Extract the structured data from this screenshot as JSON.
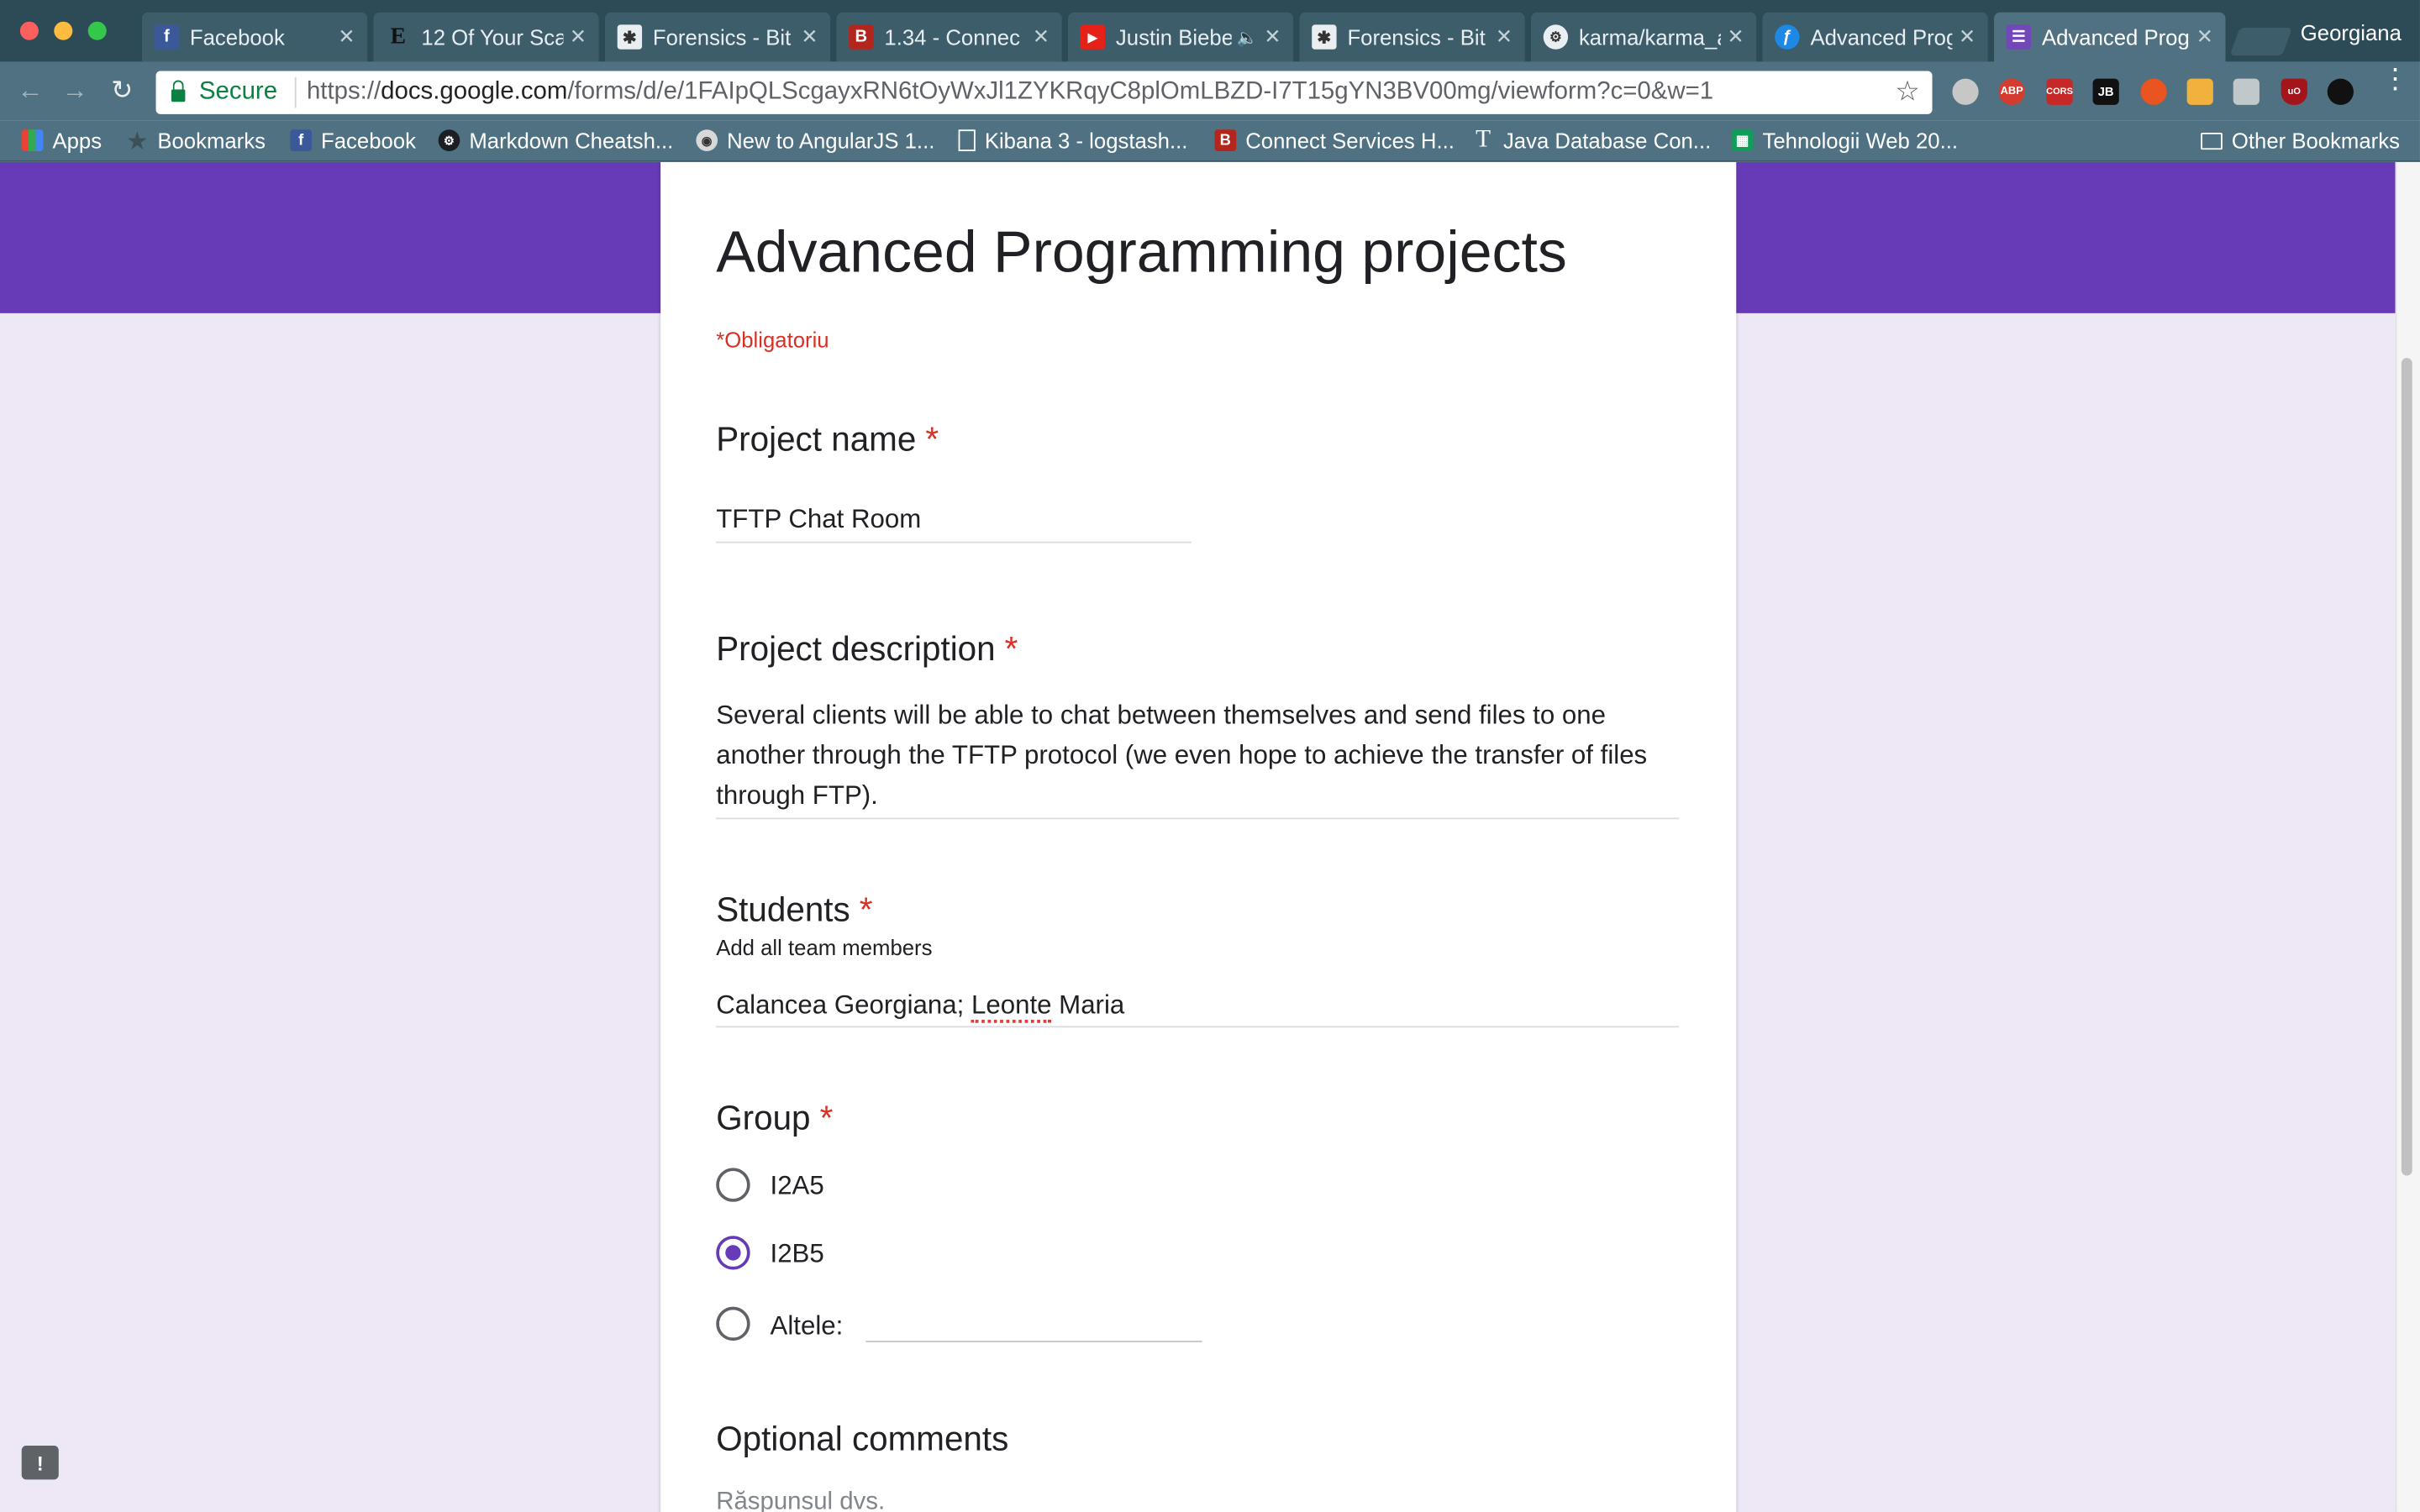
{
  "browser": {
    "tabs": [
      {
        "title": "Facebook",
        "favicon": "facebook-icon"
      },
      {
        "title": "12 Of Your Sca",
        "favicon": "esquire-icon"
      },
      {
        "title": "Forensics - Bit",
        "favicon": "bitbucket-icon"
      },
      {
        "title": "1.34 - Connec",
        "favicon": "b-icon"
      },
      {
        "title": "Justin Biebe",
        "favicon": "youtube-icon"
      },
      {
        "title": "Forensics - Bit",
        "favicon": "bitbucket-icon"
      },
      {
        "title": "karma/karma_a",
        "favicon": "github-icon"
      },
      {
        "title": "Advanced Prog",
        "favicon": "forms-icon"
      },
      {
        "title": "Advanced Prog",
        "favicon": "forms-icon",
        "active": true
      }
    ],
    "profile_name": "Georgiana",
    "secure_label": "Secure",
    "url_scheme": "https://",
    "url_host": "docs.google.com",
    "url_path": "/forms/d/e/1FAIpQLScgayxRN6tOyWxJl1ZYKRqyC8plOmLBZD-I7T15gYN3BV00mg/viewform?c=0&w=1",
    "extensions": [
      {
        "name": "ghostery-icon",
        "label": "",
        "color": "#c7c7c7"
      },
      {
        "name": "adblock-icon",
        "label": "ABP",
        "color": "#d43c2f"
      },
      {
        "name": "cors-icon",
        "label": "CORS",
        "color": "#c62828"
      },
      {
        "name": "jetbrains-icon",
        "label": "JB",
        "color": "#111111"
      },
      {
        "name": "ubuntu-icon",
        "label": "",
        "color": "#e95420"
      },
      {
        "name": "postman-icon",
        "label": "",
        "color": "#f0b23c"
      },
      {
        "name": "extension-icon",
        "label": "",
        "color": "#c0c8cc"
      },
      {
        "name": "ublock-icon",
        "label": "uO",
        "color": "#a3151a"
      },
      {
        "name": "bomb-icon",
        "label": "",
        "color": "#111111"
      }
    ]
  },
  "bookmarks": [
    {
      "label": "Apps",
      "icon": "apps-grid-icon"
    },
    {
      "label": "Bookmarks",
      "icon": "star-icon"
    },
    {
      "label": "Facebook",
      "icon": "facebook-icon"
    },
    {
      "label": "Markdown Cheatsh...",
      "icon": "github-icon"
    },
    {
      "label": "New to AngularJS 1...",
      "icon": "owl-icon"
    },
    {
      "label": "Kibana 3 - logstash...",
      "icon": "page-icon"
    },
    {
      "label": "Connect Services H...",
      "icon": "b-icon"
    },
    {
      "label": "Java Database Con...",
      "icon": "t-icon"
    },
    {
      "label": "Tehnologii Web 20...",
      "icon": "sheets-icon"
    },
    {
      "label": "Other Bookmarks",
      "icon": "folder-icon"
    }
  ],
  "form": {
    "title": "Advanced Programming projects",
    "required_note": "*Obligatoriu",
    "required_mark": "*",
    "questions": {
      "project_name": {
        "title": "Project name",
        "value": "TFTP Chat Room"
      },
      "project_description": {
        "title": "Project description",
        "value": "Several clients will be able to chat between themselves and send files to one another through the TFTP protocol (we even hope to achieve the transfer of files through FTP)."
      },
      "students": {
        "title": "Students",
        "help": "Add all team members",
        "value_part1": "Calancea Georgiana; ",
        "value_part2": "Leonte",
        "value_part3": " Maria"
      },
      "group": {
        "title": "Group",
        "options": [
          {
            "label": "I2A5",
            "selected": false
          },
          {
            "label": "I2B5",
            "selected": true
          },
          {
            "label": "Altele:",
            "selected": false
          }
        ]
      },
      "optional_comments": {
        "title": "Optional comments",
        "placeholder": "Răspunsul dvs."
      }
    }
  },
  "colors": {
    "accent": "#673ab7",
    "required": "#d93025",
    "background": "#ede7f6"
  }
}
